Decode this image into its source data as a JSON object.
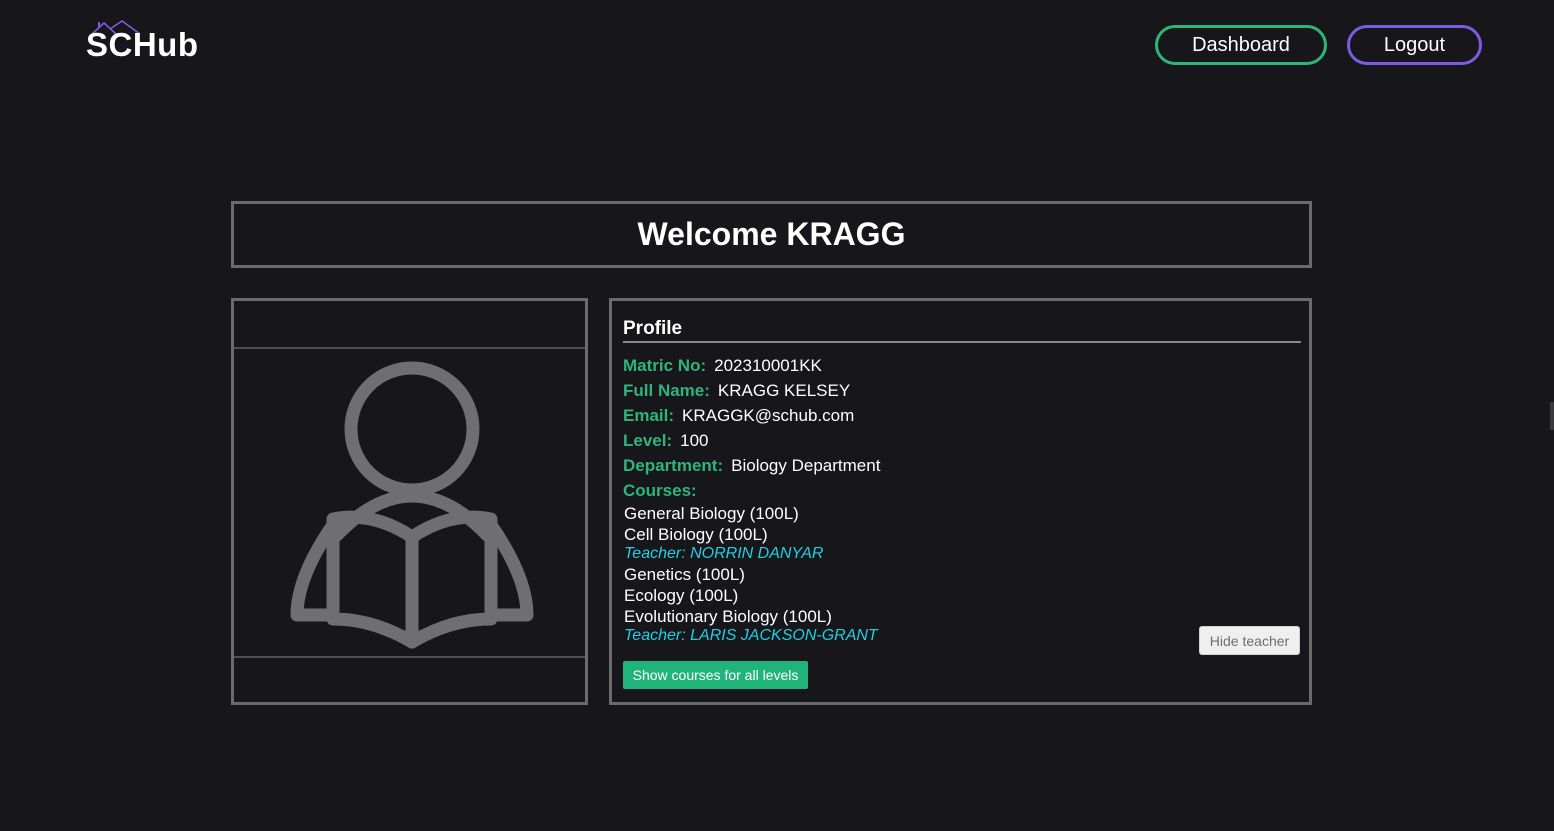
{
  "header": {
    "logo_text": "SCHub",
    "dashboard_label": "Dashboard",
    "logout_label": "Logout"
  },
  "welcome": {
    "title": "Welcome KRAGG"
  },
  "profile": {
    "title": "Profile",
    "fields": [
      {
        "label": "Matric No:",
        "value": "202310001KK"
      },
      {
        "label": "Full Name:",
        "value": "KRAGG KELSEY"
      },
      {
        "label": "Email:",
        "value": "KRAGGK@schub.com"
      },
      {
        "label": "Level:",
        "value": "100"
      },
      {
        "label": "Department:",
        "value": "Biology Department"
      }
    ],
    "courses_label": "Courses:",
    "courses": [
      {
        "name": "General Biology (100L)"
      },
      {
        "name": "Cell Biology (100L)",
        "teacher": "Teacher: NORRIN DANYAR"
      },
      {
        "name": "Genetics (100L)"
      },
      {
        "name": "Ecology (100L)"
      },
      {
        "name": "Evolutionary Biology (100L)",
        "teacher": "Teacher: LARIS JACKSON-GRANT"
      }
    ],
    "hide_teacher_label": "Hide teacher",
    "show_all_label": "Show courses for all levels"
  },
  "colors": {
    "background": "#16161b",
    "accent_green": "#2eb57c",
    "accent_purple": "#7c5ce0",
    "teacher_cyan": "#1fd0e0",
    "border_gray": "#6b6b6e"
  },
  "icons": {
    "avatar": "reader-avatar-icon",
    "logo_roof": "house-roof-icon"
  }
}
